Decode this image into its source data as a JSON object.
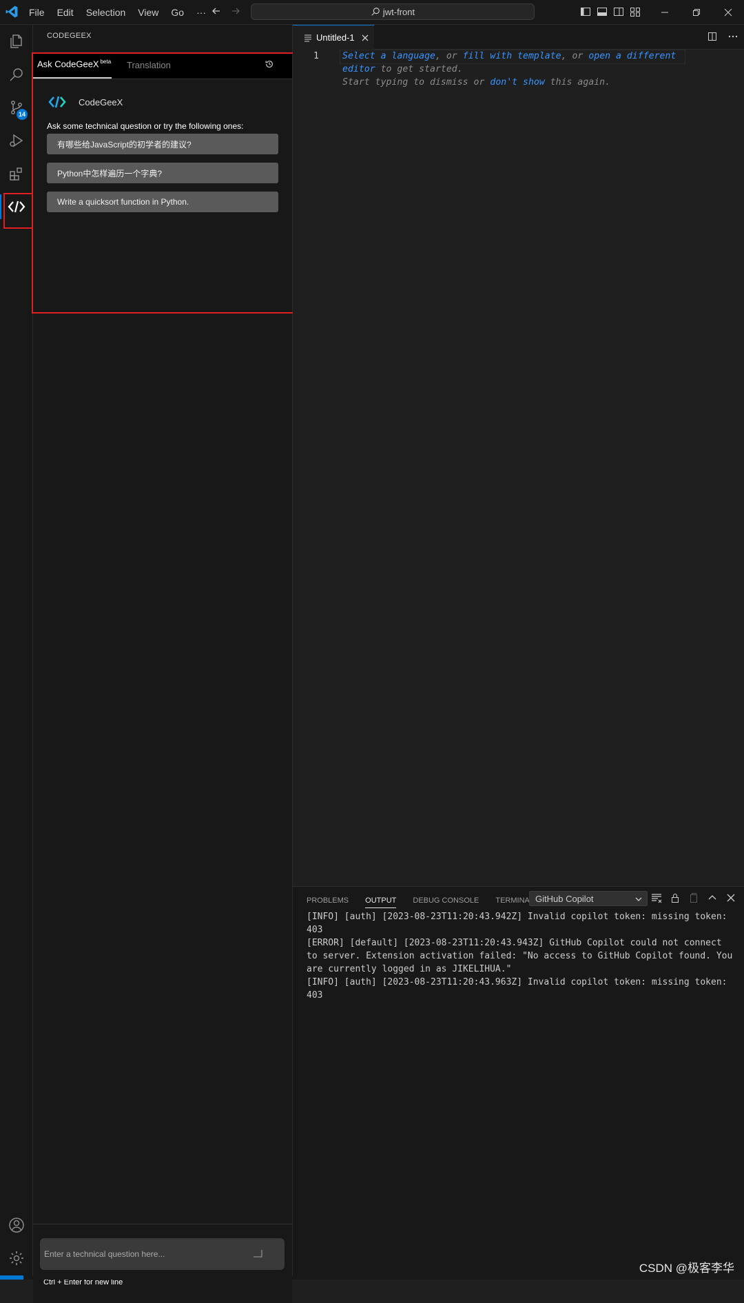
{
  "titlebar": {
    "menu": [
      "File",
      "Edit",
      "Selection",
      "View",
      "Go",
      "···"
    ],
    "search": "jwt-front"
  },
  "activity": {
    "scm_badge": "14"
  },
  "sidebar": {
    "title": "CODEGEEX",
    "tabs": {
      "ask": "Ask CodeGeeX",
      "ask_sup": "beta",
      "translation": "Translation"
    },
    "brand": "CodeGeeX",
    "prompt": "Ask some technical question or try the following ones:",
    "suggestions": [
      "有哪些给JavaScript的初学者的建议?",
      "Python中怎样遍历一个字典?",
      "Write a quicksort function in Python."
    ],
    "input_placeholder": "Enter a technical question here...",
    "hint": "Ctrl + Enter for new line"
  },
  "editor": {
    "tab_label": "Untitled-1",
    "line_number": "1",
    "hint": {
      "link1": "Select a language",
      "sep1": ", or ",
      "link2": "fill with template",
      "sep2": ", or ",
      "link3": "open a different editor",
      "tail1": " to get started.",
      "line2_start": "Start typing to dismiss or ",
      "link4": "don't show",
      "line2_end": " this again."
    }
  },
  "panel": {
    "tabs": [
      "PROBLEMS",
      "OUTPUT",
      "DEBUG CONSOLE",
      "TERMINAL"
    ],
    "active_tab": "OUTPUT",
    "channel": "GitHub Copilot",
    "log": [
      "[INFO] [auth] [2023-08-23T11:20:43.942Z] Invalid copilot token: missing token: 403",
      "[ERROR] [default] [2023-08-23T11:20:43.943Z] GitHub Copilot could not connect to server. Extension activation failed: \"No access to GitHub Copilot found. You are currently logged in as JIKELIHUA.\"",
      "[INFO] [auth] [2023-08-23T11:20:43.963Z] Invalid copilot token: missing token: 403"
    ]
  },
  "watermark": "CSDN @极客李华",
  "colors": {
    "accent": "#0078d4",
    "link": "#3794ff",
    "highlight": "#e02020"
  }
}
